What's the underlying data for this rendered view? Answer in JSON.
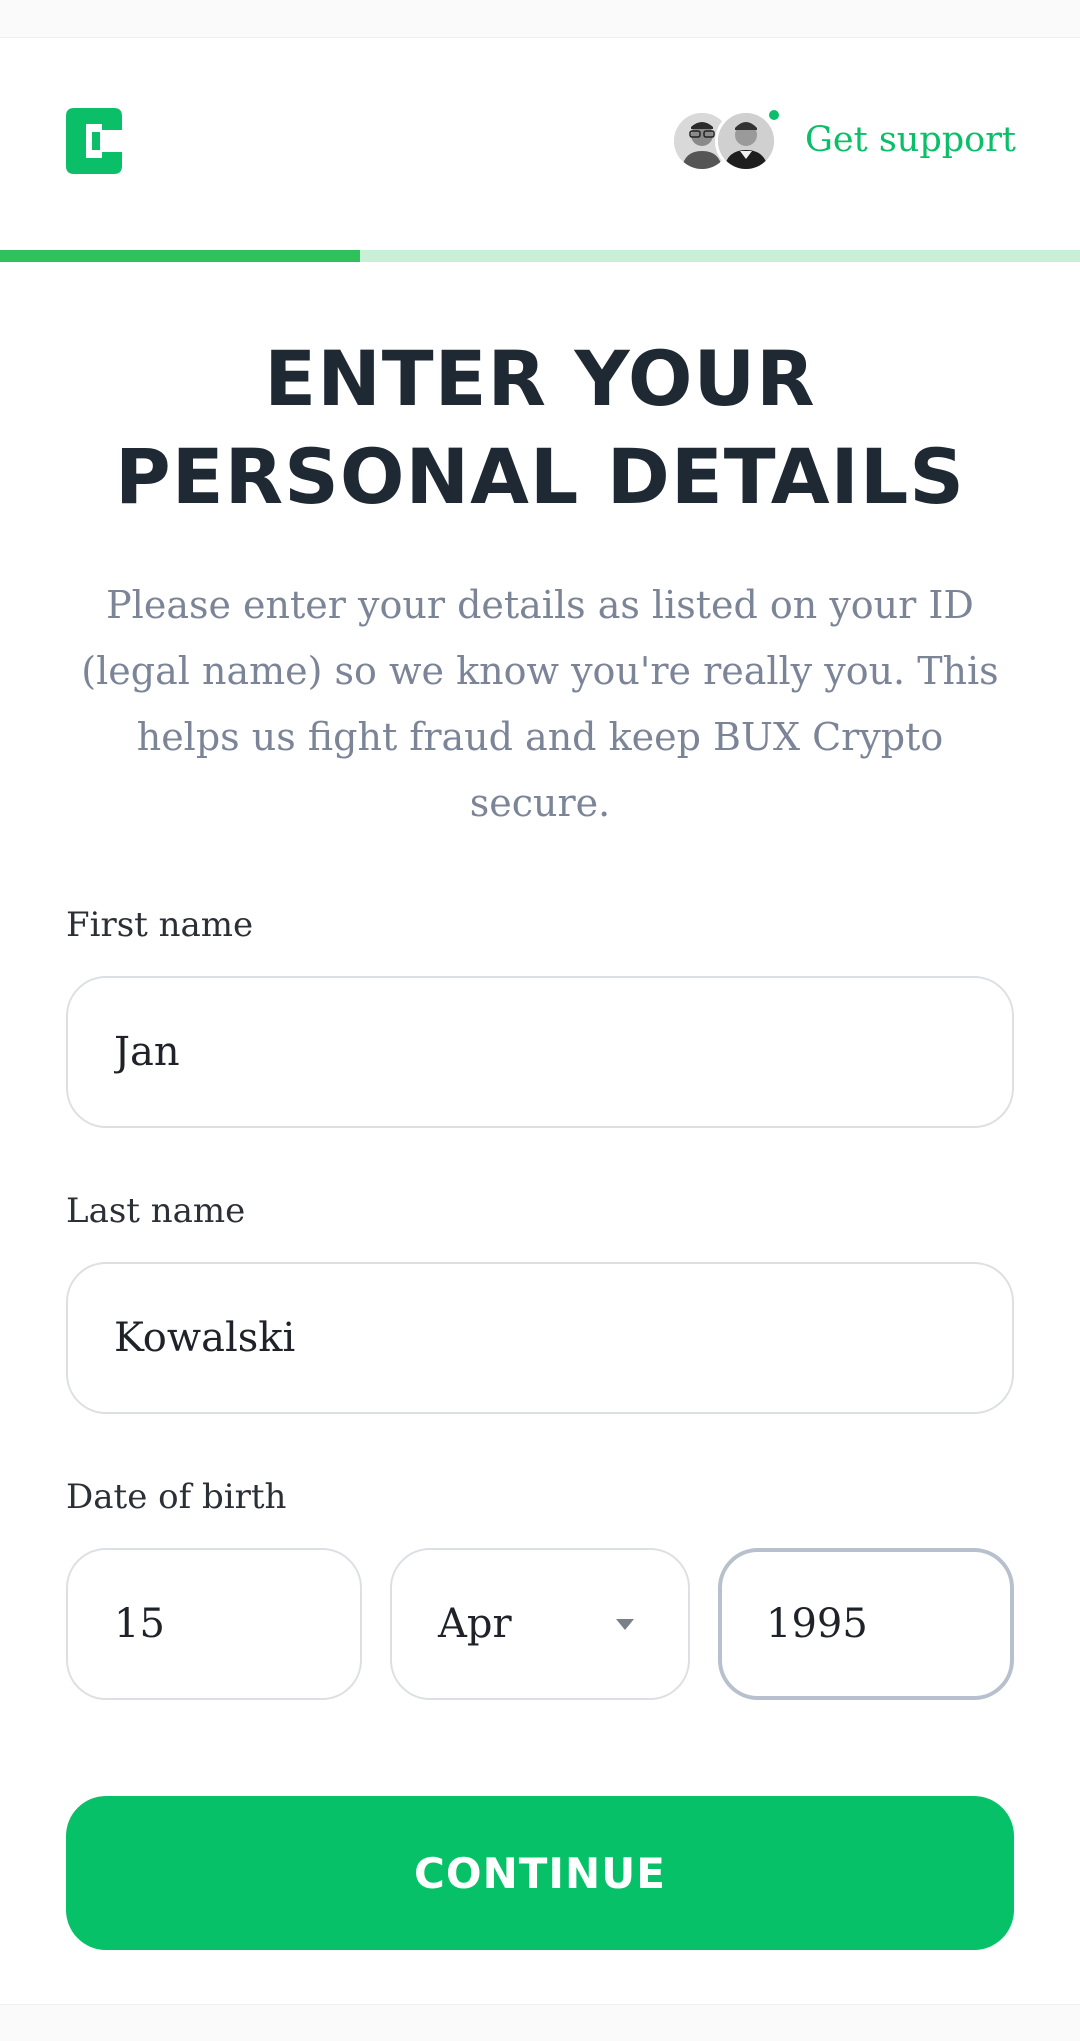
{
  "header": {
    "logo_icon": "bux-crypto-c-logo",
    "support_label": "Get support",
    "support_avatars": [
      "support-agent-1",
      "support-agent-2"
    ],
    "online_status_color": "#0bbf69"
  },
  "progress": {
    "fraction": 0.333
  },
  "main": {
    "title": "ENTER YOUR PERSONAL DETAILS",
    "subtitle": "Please enter your details as listed on your ID (legal name) so we know you're really you. This helps us fight fraud and keep BUX Crypto secure."
  },
  "form": {
    "first_name": {
      "label": "First name",
      "value": "Jan"
    },
    "last_name": {
      "label": "Last name",
      "value": "Kowalski"
    },
    "date_of_birth": {
      "label": "Date of birth",
      "day": "15",
      "month": "Apr",
      "year": "1995"
    },
    "continue_label": "CONTINUE"
  },
  "colors": {
    "accent": "#06c167",
    "title": "#1f2933",
    "subtitle": "#7c8598",
    "progress_fill": "#2fc15b",
    "progress_track": "#c9efd6"
  }
}
